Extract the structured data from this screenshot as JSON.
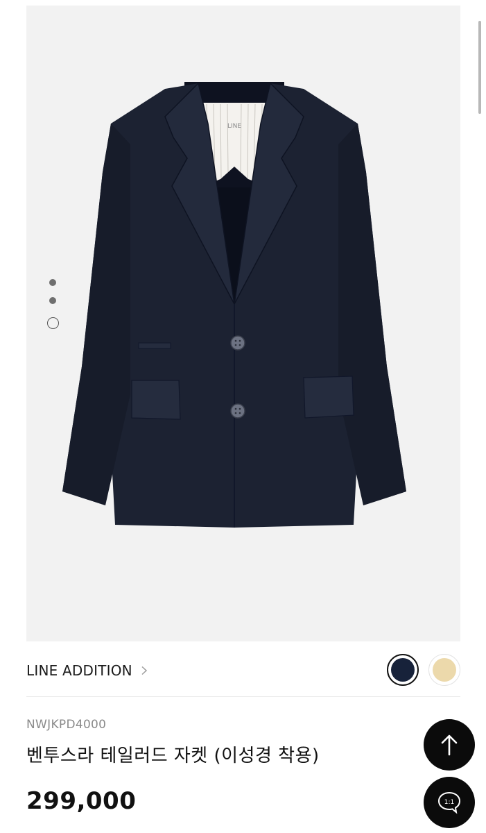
{
  "product": {
    "brand": "LINE ADDITION",
    "code": "NWJKPD4000",
    "title": "벤투스라 테일러드 자켓 (이성경 착용)",
    "price": "299,000",
    "label_tag": "LINE",
    "image_subject": "navy tailored jacket"
  },
  "gallery": {
    "indicator_count": 3,
    "active_index": 2
  },
  "colors": {
    "swatches": [
      {
        "name": "navy",
        "hex": "#17223a",
        "selected": true
      },
      {
        "name": "beige",
        "hex": "#ecd9ab",
        "selected": false
      }
    ],
    "background": "#f2f2f2",
    "fab": "#0b0b0b"
  },
  "buttons": {
    "chat_label": "1:1"
  },
  "icons": {
    "brand_link": "chevron-right-icon",
    "scroll_top": "arrow-up-icon",
    "chat": "chat-bubble-icon"
  }
}
